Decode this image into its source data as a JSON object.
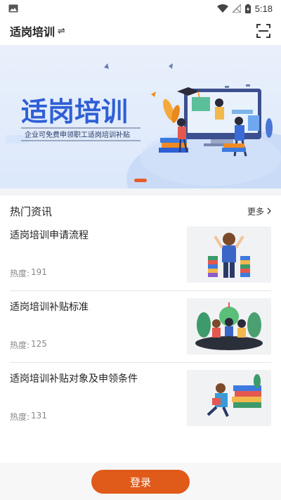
{
  "status_bar": {
    "time": "5:18"
  },
  "header": {
    "title": "适岗培训",
    "swap_glyph": "⇌"
  },
  "banner": {
    "headline": "适岗培训",
    "subtitle": "企业可免费申领职工适岗培训补贴"
  },
  "section": {
    "title": "热门资讯",
    "more_label": "更多"
  },
  "news": [
    {
      "title": "适岗培训申请流程",
      "heat_label": "热度:",
      "heat_value": "191"
    },
    {
      "title": "适岗培训补贴标准",
      "heat_label": "热度:",
      "heat_value": "125"
    },
    {
      "title": "适岗培训补贴对象及申领条件",
      "heat_label": "热度:",
      "heat_value": "131"
    }
  ],
  "bottom": {
    "login_label": "登录"
  },
  "colors": {
    "accent": "#e05a1a",
    "banner_blue": "#2f5fd6",
    "banner_orange": "#f08a24"
  }
}
